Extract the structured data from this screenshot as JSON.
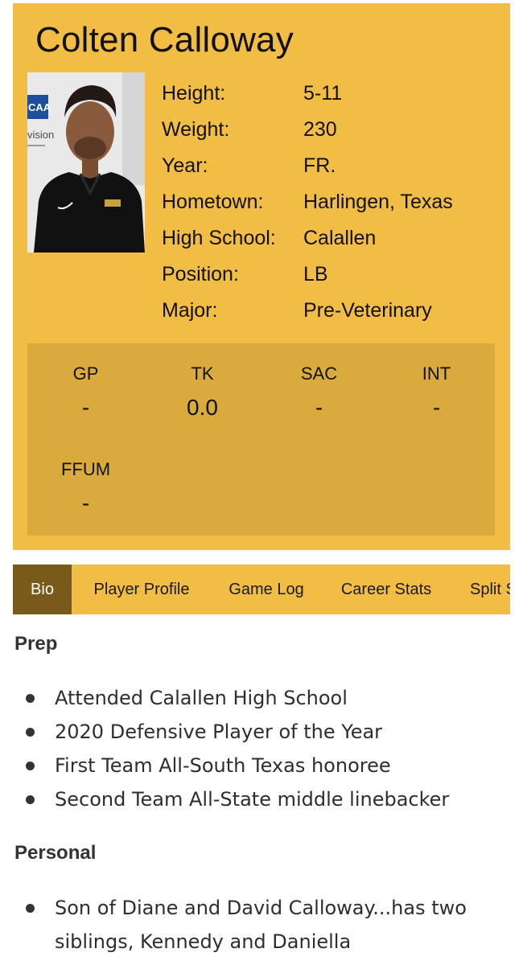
{
  "player": {
    "name": "Colten Calloway",
    "photo_alt": "Colten Calloway headshot",
    "info": [
      {
        "label": "Height:",
        "value": "5-11"
      },
      {
        "label": "Weight:",
        "value": "230"
      },
      {
        "label": "Year:",
        "value": "FR."
      },
      {
        "label": "Hometown:",
        "value": "Harlingen, Texas"
      },
      {
        "label": "High School:",
        "value": "Calallen"
      },
      {
        "label": "Position:",
        "value": "LB"
      },
      {
        "label": "Major:",
        "value": "Pre-Veterinary"
      }
    ]
  },
  "stats": [
    {
      "label": "GP",
      "value": "-"
    },
    {
      "label": "TK",
      "value": "0.0"
    },
    {
      "label": "SAC",
      "value": "-"
    },
    {
      "label": "INT",
      "value": "-"
    },
    {
      "label": "FFUM",
      "value": "-"
    }
  ],
  "tabs": [
    {
      "label": "Bio",
      "active": true
    },
    {
      "label": "Player Profile",
      "active": false
    },
    {
      "label": "Game Log",
      "active": false
    },
    {
      "label": "Career Stats",
      "active": false
    },
    {
      "label": "Split Stats",
      "active": false
    }
  ],
  "bio": {
    "prep_title": "Prep",
    "prep_items": [
      "Attended Calallen High School",
      "2020 Defensive Player of the Year",
      "First Team All-South Texas honoree",
      "Second Team All-State middle linebacker"
    ],
    "personal_title": "Personal",
    "personal_items": [
      "Son of Diane and David Calloway...has two siblings, Kennedy and Daniella"
    ]
  },
  "colors": {
    "card_background": "#f2bd45",
    "stats_background": "#d8ab3c",
    "active_tab": "#7a5a1a"
  },
  "icons": {
    "bullet": "bullet-dot-icon"
  }
}
